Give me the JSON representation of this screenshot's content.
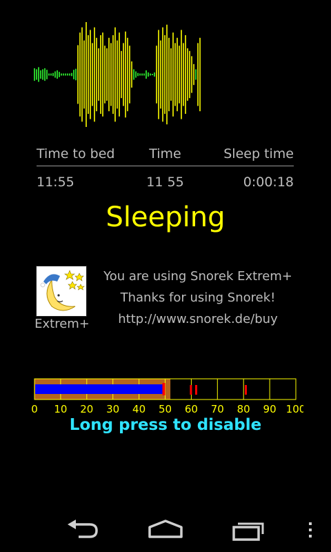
{
  "waveform": {
    "quiet_color": "#33ff33",
    "loud_color": "#ffff00",
    "samples": [
      0.12,
      0.1,
      0.14,
      0.08,
      0.1,
      0.12,
      0.09,
      0.02,
      0.02,
      0.03,
      0.06,
      0.08,
      0.05,
      0.02,
      0.02,
      0.02,
      0.02,
      0.02,
      0.03,
      0.09,
      0.11,
      0.56,
      0.8,
      0.9,
      0.65,
      1.0,
      0.75,
      0.85,
      0.6,
      0.9,
      0.7,
      0.5,
      0.75,
      0.8,
      0.55,
      0.5,
      0.7,
      0.6,
      0.75,
      0.9,
      0.65,
      0.8,
      0.45,
      0.6,
      0.82,
      0.7,
      0.55,
      0.25,
      0.1,
      0.06,
      0.03,
      0.02,
      0.02,
      0.02,
      0.08,
      0.04,
      0.02,
      0.01,
      0.04,
      0.55,
      0.85,
      0.65,
      0.9,
      0.75,
      0.95,
      0.7,
      0.5,
      0.8,
      0.6,
      0.7,
      0.55,
      0.85,
      0.6,
      0.75,
      0.5,
      0.45,
      0.35,
      0.2,
      0.1,
      0.6,
      0.7
    ]
  },
  "stats": {
    "headers": [
      "Time to bed",
      "Time",
      "Sleep time"
    ],
    "values": [
      "11:55",
      "11 55",
      "0:00:18"
    ]
  },
  "status": "Sleeping",
  "promo": {
    "logo_label": "Extrem+",
    "lines": [
      "You are using Snorek Extrem+",
      "Thanks for using Snorek!",
      "http://www.snorek.de/buy"
    ]
  },
  "meter": {
    "level": 49,
    "peak": 50,
    "threshold": 52,
    "markers": [
      60,
      62,
      81
    ],
    "tick_labels": [
      "0",
      "10",
      "20",
      "30",
      "40",
      "50",
      "60",
      "70",
      "80",
      "90",
      "100"
    ],
    "colors": {
      "fill": "#0000ff",
      "band": "#b5651d",
      "peak": "#ff0000",
      "grid": "#ffff00",
      "ticks": "#ffff00"
    }
  },
  "hint": "Long press to disable",
  "nav": {
    "back": "back-icon",
    "home": "home-icon",
    "recent": "recent-apps-icon",
    "menu": "overflow-menu-icon"
  }
}
